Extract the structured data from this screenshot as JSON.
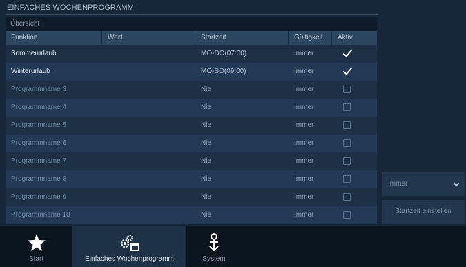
{
  "page": {
    "title": "EINFACHES WOCHENPROGRAMM"
  },
  "overview": {
    "label": "Übersicht"
  },
  "table": {
    "headers": [
      "Funktion",
      "Wert",
      "Startzeit",
      "Gültigkeit",
      "Aktiv"
    ],
    "rows": [
      {
        "funktion": "Sommerurlaub",
        "wert": "",
        "startzeit": "MO-DO(07:00)",
        "gueltigkeit": "Immer",
        "aktiv": true
      },
      {
        "funktion": "Winterurlaub",
        "wert": "",
        "startzeit": "MO-SO(09:00)",
        "gueltigkeit": "Immer",
        "aktiv": true
      },
      {
        "funktion": "Programmname 3",
        "wert": "",
        "startzeit": "Nie",
        "gueltigkeit": "Immer",
        "aktiv": false
      },
      {
        "funktion": "Programmname 4",
        "wert": "",
        "startzeit": "Nie",
        "gueltigkeit": "Immer",
        "aktiv": false
      },
      {
        "funktion": "Programmname 5",
        "wert": "",
        "startzeit": "Nie",
        "gueltigkeit": "Immer",
        "aktiv": false
      },
      {
        "funktion": "Programmname 6",
        "wert": "",
        "startzeit": "Nie",
        "gueltigkeit": "Immer",
        "aktiv": false
      },
      {
        "funktion": "Programmname 7",
        "wert": "",
        "startzeit": "Nie",
        "gueltigkeit": "Immer",
        "aktiv": false
      },
      {
        "funktion": "Programmname 8",
        "wert": "",
        "startzeit": "Nie",
        "gueltigkeit": "Immer",
        "aktiv": false
      },
      {
        "funktion": "Programmname 9",
        "wert": "",
        "startzeit": "Nie",
        "gueltigkeit": "Immer",
        "aktiv": false
      },
      {
        "funktion": "Programmname 10",
        "wert": "",
        "startzeit": "Nie",
        "gueltigkeit": "Immer",
        "aktiv": false
      }
    ]
  },
  "side": {
    "validity_select": {
      "value": "Immer",
      "icon": "chevron-down-icon"
    },
    "set_start_button": "Startzeit einstellen"
  },
  "nav": {
    "items": [
      {
        "label": "Start",
        "icon": "star-icon",
        "selected": false
      },
      {
        "label": "Einfaches Wochenprogramm",
        "icon": "gears-calendar-icon",
        "selected": true
      },
      {
        "label": "System",
        "icon": "system-icon",
        "selected": false
      }
    ]
  },
  "colors": {
    "background": "#17273a",
    "header_row": "#2d465f",
    "nav_bar": "#0b1520"
  }
}
